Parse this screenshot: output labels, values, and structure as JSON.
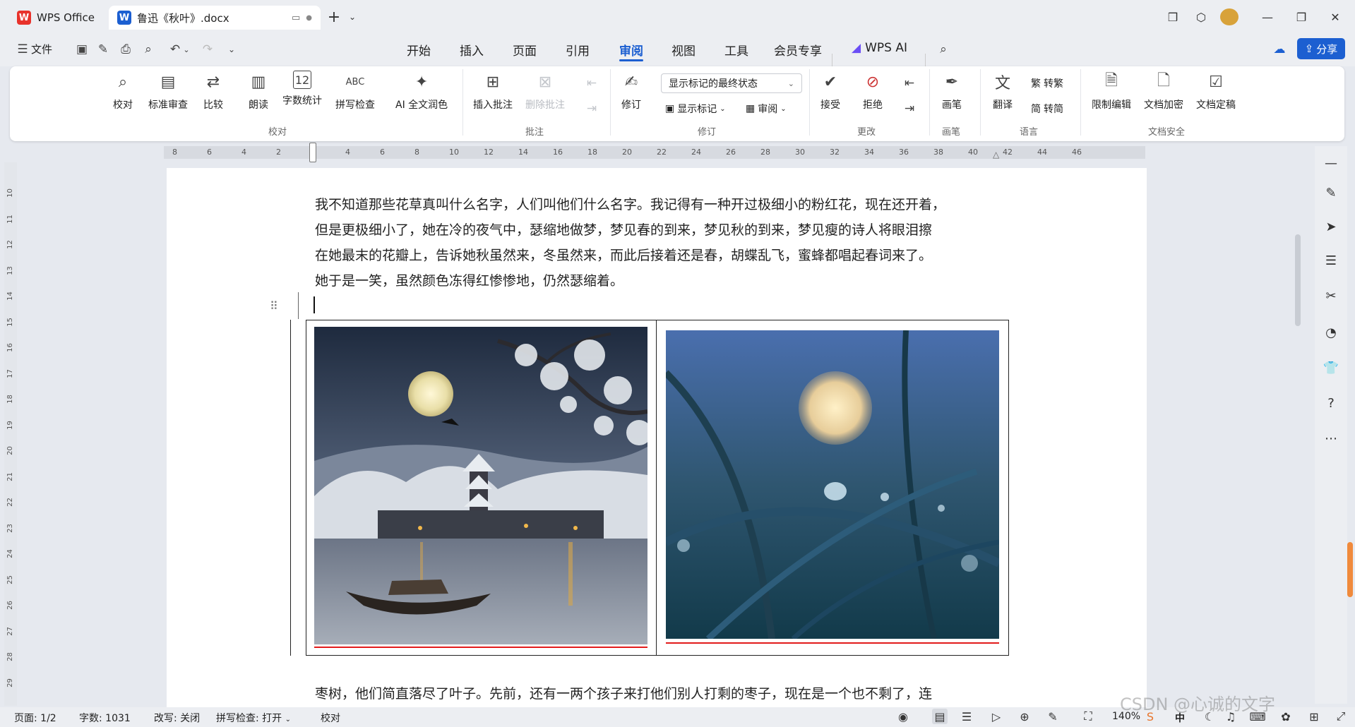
{
  "tabs": [
    {
      "label": "WPS Office",
      "logo": "W"
    },
    {
      "label": "鲁迅《秋叶》.docx",
      "logo": "W"
    }
  ],
  "tab_icons": [
    "screen-icon",
    "dot-icon",
    "plus-icon",
    "chevron-down-icon"
  ],
  "window_controls": {
    "minimize": "—",
    "restore": "❐",
    "close": "✕"
  },
  "file_menu": "文件",
  "menu": [
    "开始",
    "插入",
    "页面",
    "引用",
    "审阅",
    "视图",
    "工具",
    "会员专享",
    "WPS AI"
  ],
  "active_menu": "审阅",
  "share_label": "分享",
  "ribbon": {
    "proof": [
      "校对",
      "标准审查",
      "比较",
      "朗读",
      "字数统计",
      "拼写检查",
      "AI 全文润色"
    ],
    "comment_insert": "插入批注",
    "comment_delete": "删除批注",
    "markup_dropdown": "显示标记的最终状态",
    "track": "修订",
    "show_markup": "显示标记",
    "review": "审阅",
    "accept": "接受",
    "reject": "拒绝",
    "pen": "画笔",
    "translate": "翻译",
    "to_traditional": "转繁",
    "to_simplified": "转简",
    "restrict": "限制编辑",
    "encrypt": "文档加密",
    "finalize": "文档定稿",
    "groups": [
      "校对",
      "批注",
      "修订",
      "更改",
      "画笔",
      "语言",
      "文档安全"
    ]
  },
  "ruler_h": [
    "8",
    "6",
    "4",
    "2",
    "2",
    "4",
    "6",
    "8",
    "10",
    "12",
    "14",
    "16",
    "18",
    "20",
    "22",
    "24",
    "26",
    "28",
    "30",
    "32",
    "34",
    "36",
    "38",
    "40",
    "42",
    "44",
    "46"
  ],
  "ruler_v": [
    "10",
    "11",
    "12",
    "13",
    "14",
    "15",
    "16",
    "17",
    "18",
    "19",
    "20",
    "21",
    "22",
    "23",
    "24",
    "25",
    "26",
    "27",
    "28",
    "29"
  ],
  "document": {
    "para1_lines": [
      "我不知道那些花草真叫什么名字，人们叫他们什么名字。我记得有一种开过极细小的粉红花，现在还开着，",
      "但是更极细小了，她在冷的夜气中，瑟缩地做梦，梦见春的到来，梦见秋的到来，梦见瘦的诗人将眼泪擦",
      "在她最末的花瓣上，告诉她秋虽然来，冬虽然来，而此后接着还是春，胡蝶乱飞，蜜蜂都唱起春词来了。",
      "她于是一笑，虽然颜色冻得红惨惨地，仍然瑟缩着。"
    ],
    "para2": "枣树，他们简直落尽了叶子。先前，还有一两个孩子来打他们别人打剩的枣子，现在是一个也不剩了，连"
  },
  "status": {
    "page": "页面: 1/2",
    "words": "字数: 1031",
    "revise": "改写: 关闭",
    "spell": "拼写检查: 打开",
    "proof": "校对",
    "zoom": "140%",
    "watermark": "CSDN @心诚的文字",
    "ime": "中"
  },
  "colors": {
    "accent": "#1c5fd1",
    "red": "#e21b1b",
    "wps_red": "#e8322b"
  }
}
